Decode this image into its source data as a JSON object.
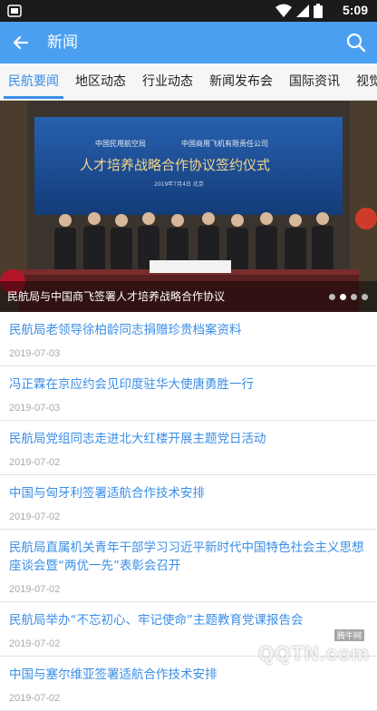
{
  "status_bar": {
    "time": "5:09",
    "icons": [
      "notification-icon",
      "wifi-icon",
      "signal-icon",
      "battery-icon"
    ]
  },
  "app_bar": {
    "title": "新闻"
  },
  "tabs": [
    {
      "label": "民航要闻",
      "active": true
    },
    {
      "label": "地区动态",
      "active": false
    },
    {
      "label": "行业动态",
      "active": false
    },
    {
      "label": "新闻发布会",
      "active": false
    },
    {
      "label": "国际资讯",
      "active": false
    },
    {
      "label": "视觉",
      "active": false
    }
  ],
  "banner": {
    "caption": "民航局与中国商飞签署人才培养战略合作协议",
    "backdrop_line1_left": "中国民用航空局",
    "backdrop_line1_right": "中国商用飞机有限责任公司",
    "backdrop_title": "人才培养战略合作协议签约仪式",
    "backdrop_date": "2019年7月4日 北京",
    "dots_count": 4,
    "active_dot": 1
  },
  "news": [
    {
      "title": "民航局老领导徐柏龄同志捐赠珍贵档案资料",
      "date": "2019-07-03"
    },
    {
      "title": "冯正霖在京应约会见印度驻华大使唐勇胜一行",
      "date": "2019-07-03"
    },
    {
      "title": "民航局党组同志走进北大红楼开展主题党日活动",
      "date": "2019-07-02"
    },
    {
      "title": "中国与匈牙利签署适航合作技术安排",
      "date": "2019-07-02"
    },
    {
      "title": "民航局直属机关青年干部学习习近平新时代中国特色社会主义思想座谈会暨“两优一先”表彰会召开",
      "date": "2019-07-02"
    },
    {
      "title": "民航局举办“不忘初心、牢记使命”主题教育党课报告会",
      "date": "2019-07-02"
    },
    {
      "title": "中国与塞尔维亚签署适航合作技术安排",
      "date": "2019-07-02"
    }
  ],
  "watermark": {
    "small": "腾牛网",
    "big": "QQTN.com"
  },
  "colors": {
    "app_bar": "#4a9ff0",
    "accent": "#3a8ee6",
    "status_bar": "#1b1b1b"
  }
}
